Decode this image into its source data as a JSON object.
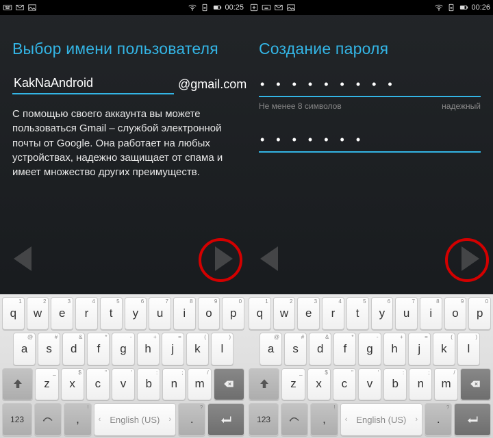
{
  "left": {
    "status": {
      "time": "00:25"
    },
    "title": "Выбор имени пользователя",
    "username_value": "KakNaAndroid",
    "domain_suffix": "@gmail.com",
    "description": "С помощью своего аккаунта вы можете пользоваться Gmail – службой электронной почты от Google. Она работает на любых устройствах, надежно защищает от спама и имеет множество других преимуществ."
  },
  "right": {
    "status": {
      "time": "00:26"
    },
    "title": "Создание пароля",
    "password_mask": "• • • • • • • • •",
    "confirm_mask": "• • • • • • •",
    "helper_left": "Не менее 8 символов",
    "helper_right": "надежный"
  },
  "keyboard": {
    "row1": [
      {
        "k": "q",
        "s": "1"
      },
      {
        "k": "w",
        "s": "2"
      },
      {
        "k": "e",
        "s": "3"
      },
      {
        "k": "r",
        "s": "4"
      },
      {
        "k": "t",
        "s": "5"
      },
      {
        "k": "y",
        "s": "6"
      },
      {
        "k": "u",
        "s": "7"
      },
      {
        "k": "i",
        "s": "8"
      },
      {
        "k": "o",
        "s": "9"
      },
      {
        "k": "p",
        "s": "0"
      }
    ],
    "row2": [
      {
        "k": "a",
        "s": "@"
      },
      {
        "k": "s",
        "s": "#"
      },
      {
        "k": "d",
        "s": "&"
      },
      {
        "k": "f",
        "s": "*"
      },
      {
        "k": "g",
        "s": "-"
      },
      {
        "k": "h",
        "s": "+"
      },
      {
        "k": "j",
        "s": "="
      },
      {
        "k": "k",
        "s": "("
      },
      {
        "k": "l",
        "s": ")"
      }
    ],
    "row3": [
      {
        "k": "z",
        "s": "_"
      },
      {
        "k": "x",
        "s": "$"
      },
      {
        "k": "c",
        "s": "\""
      },
      {
        "k": "v",
        "s": "'"
      },
      {
        "k": "b",
        "s": ":"
      },
      {
        "k": "n",
        "s": ";"
      },
      {
        "k": "m",
        "s": "/"
      }
    ],
    "numkey": "123",
    "space_label": "English (US)",
    "comma_sup": "!",
    "period_sup": "?"
  }
}
